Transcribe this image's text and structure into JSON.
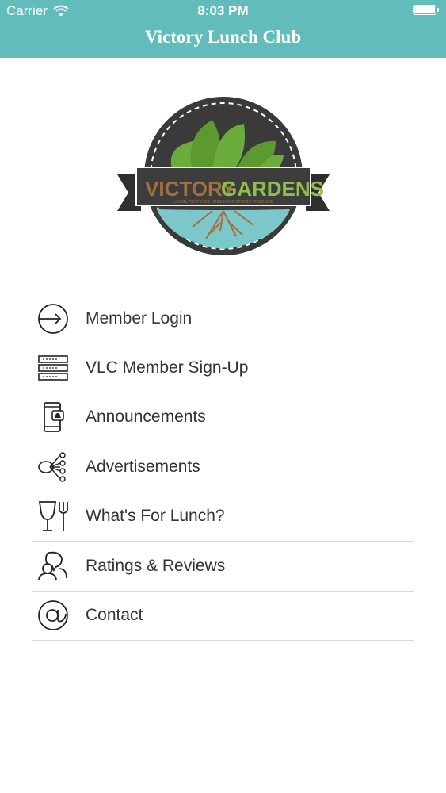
{
  "status_bar": {
    "carrier": "Carrier",
    "time": "8:03 PM"
  },
  "nav": {
    "title": "Victory Lunch Club"
  },
  "logo": {
    "brand_left": "VICTORY",
    "brand_right": "GARDENS",
    "tagline": "LOCAL PESTICIDE FREE HYDROPONIC PRODUCE"
  },
  "menu": {
    "items": [
      {
        "label": "Member Login",
        "icon": "login-arrow-icon"
      },
      {
        "label": "VLC Member Sign-Up",
        "icon": "server-stack-icon"
      },
      {
        "label": "Announcements",
        "icon": "phone-notification-icon"
      },
      {
        "label": "Advertisements",
        "icon": "network-nodes-icon"
      },
      {
        "label": "What's For Lunch?",
        "icon": "glass-fork-icon"
      },
      {
        "label": "Ratings & Reviews",
        "icon": "chat-people-icon"
      },
      {
        "label": "Contact",
        "icon": "at-sign-icon"
      }
    ]
  },
  "colors": {
    "header_bg": "#62bcbc",
    "header_text": "#ffffff",
    "divider": "#d8d8d8",
    "logo_badge": "#3a3a3a",
    "logo_green": "#6cac3c",
    "logo_water": "#7cc7c9",
    "logo_brand_brown": "#a3703c",
    "logo_brand_green": "#8cc04a"
  }
}
